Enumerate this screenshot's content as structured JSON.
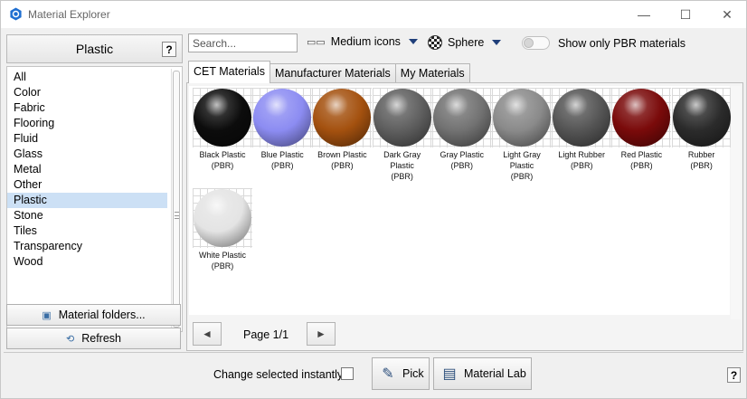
{
  "window": {
    "title": "Material Explorer",
    "icon": "hexagon-app-icon",
    "controls": {
      "minimize": "—",
      "maximize": "☐",
      "close": "✕"
    }
  },
  "sidebar": {
    "header": "Plastic",
    "help": "?",
    "categories": [
      {
        "label": "All",
        "selected": false
      },
      {
        "label": "Color",
        "selected": false
      },
      {
        "label": "Fabric",
        "selected": false
      },
      {
        "label": "Flooring",
        "selected": false
      },
      {
        "label": "Fluid",
        "selected": false
      },
      {
        "label": "Glass",
        "selected": false
      },
      {
        "label": "Metal",
        "selected": false
      },
      {
        "label": "Other",
        "selected": false
      },
      {
        "label": "Plastic",
        "selected": true
      },
      {
        "label": "Stone",
        "selected": false
      },
      {
        "label": "Tiles",
        "selected": false
      },
      {
        "label": "Transparency",
        "selected": false
      },
      {
        "label": "Wood",
        "selected": false
      }
    ],
    "folders_button": "Material folders...",
    "refresh_button": "Refresh"
  },
  "toolbar": {
    "search_placeholder": "Search...",
    "size_dropdown": "Medium icons",
    "shape_dropdown": "Sphere",
    "pbr_toggle_label": "Show only PBR materials"
  },
  "tabs": [
    {
      "label": "CET Materials",
      "active": true
    },
    {
      "label": "Manufacturer Materials",
      "active": false
    },
    {
      "label": "My Materials",
      "active": false
    }
  ],
  "materials": [
    {
      "name": "Black Plastic\n(PBR)",
      "color": "#0c0c0c"
    },
    {
      "name": "Blue Plastic\n(PBR)",
      "color": "#8c8cf2"
    },
    {
      "name": "Brown Plastic\n(PBR)",
      "color": "#a4510f"
    },
    {
      "name": "Dark Gray\nPlastic\n(PBR)",
      "color": "#5f5f5f"
    },
    {
      "name": "Gray Plastic\n(PBR)",
      "color": "#727272"
    },
    {
      "name": "Light Gray\nPlastic\n(PBR)",
      "color": "#8a8a8a"
    },
    {
      "name": "Light Rubber\n(PBR)",
      "color": "#555555"
    },
    {
      "name": "Red Plastic\n(PBR)",
      "color": "#7a0a0a"
    },
    {
      "name": "Rubber\n(PBR)",
      "color": "#2b2b2b"
    },
    {
      "name": "White Plastic\n(PBR)",
      "color": "#e4e4e4"
    }
  ],
  "pager": {
    "label": "Page 1/1",
    "prev": "◄",
    "next": "►"
  },
  "footer": {
    "change_instantly_label": "Change selected instantly:",
    "pick_button": "Pick",
    "material_lab_button": "Material Lab",
    "help": "?"
  }
}
